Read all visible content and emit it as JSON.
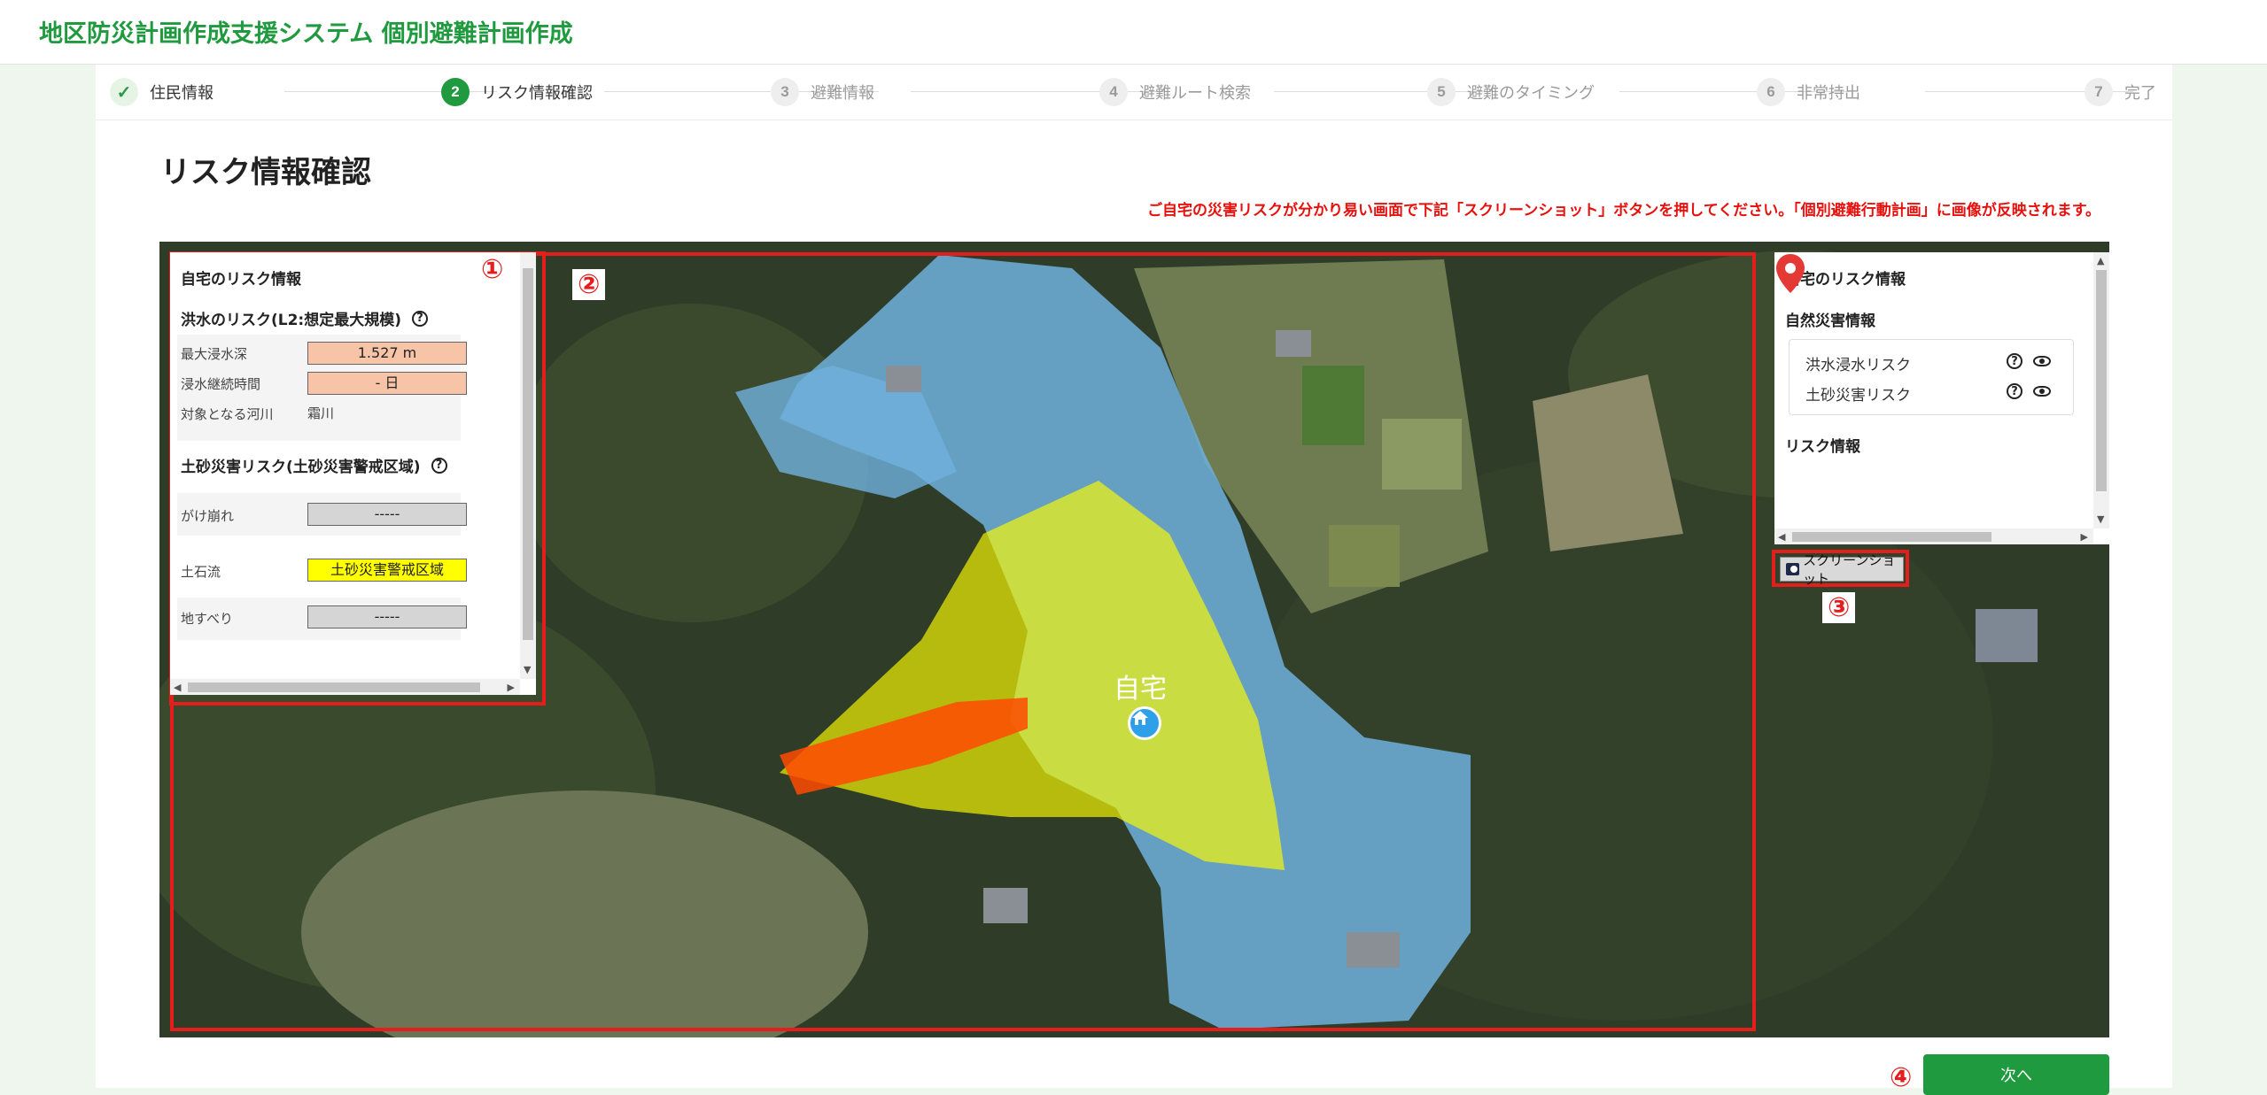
{
  "app": {
    "title": "地区防災計画作成支援システム 個別避難計画作成"
  },
  "steps": [
    {
      "num": "✓",
      "label": "住民情報",
      "state": "done"
    },
    {
      "num": "2",
      "label": "リスク情報確認",
      "state": "active"
    },
    {
      "num": "3",
      "label": "避難情報",
      "state": "pending"
    },
    {
      "num": "4",
      "label": "避難ルート検索",
      "state": "pending"
    },
    {
      "num": "5",
      "label": "避難のタイミング",
      "state": "pending"
    },
    {
      "num": "6",
      "label": "非常持出",
      "state": "pending"
    },
    {
      "num": "7",
      "label": "完了",
      "state": "pending"
    }
  ],
  "page": {
    "title": "リスク情報確認",
    "notice": "ご自宅の災害リスクが分かり易い画面で下記「スクリーンショット」ボタンを押してください。「個別避難行動計画」に画像が反映されます。"
  },
  "left_panel": {
    "title": "自宅のリスク情報",
    "flood": {
      "title": "洪水のリスク(L2:想定最大規模)",
      "rows": [
        {
          "label": "最大浸水深",
          "value": "1.527 m"
        },
        {
          "label": "浸水継続時間",
          "value": "- 日"
        },
        {
          "label": "対象となる河川",
          "value": "霜川"
        }
      ]
    },
    "landslide": {
      "title": "土砂災害リスク(土砂災害警戒区域)",
      "rows": [
        {
          "label": "がけ崩れ",
          "value": "-----"
        },
        {
          "label": "土石流",
          "value": "土砂災害警戒区域"
        },
        {
          "label": "地すべり",
          "value": "-----"
        }
      ]
    }
  },
  "right_panel": {
    "title": "自宅のリスク情報",
    "natural_title": "自然災害情報",
    "layers": [
      "洪水浸水リスク",
      "土砂災害リスク"
    ],
    "risk_title": "リスク情報"
  },
  "map": {
    "home_label": "自宅"
  },
  "screenshot_button": {
    "label": "スクリーンショット"
  },
  "annotations": [
    "①",
    "②",
    "③",
    "④"
  ],
  "next_button": {
    "label": "次へ"
  },
  "colors": {
    "brand_green": "#1f9a3e",
    "notice_red": "#e8100d",
    "flood_blue": "#6fb0dc",
    "warning_yellow": "#ffff00",
    "danger_orange": "#ff4a00",
    "pin_red": "#e53935"
  },
  "icons": [
    "check-icon",
    "help-icon",
    "eye-icon",
    "map-pin-icon",
    "camera-icon",
    "home-icon"
  ]
}
